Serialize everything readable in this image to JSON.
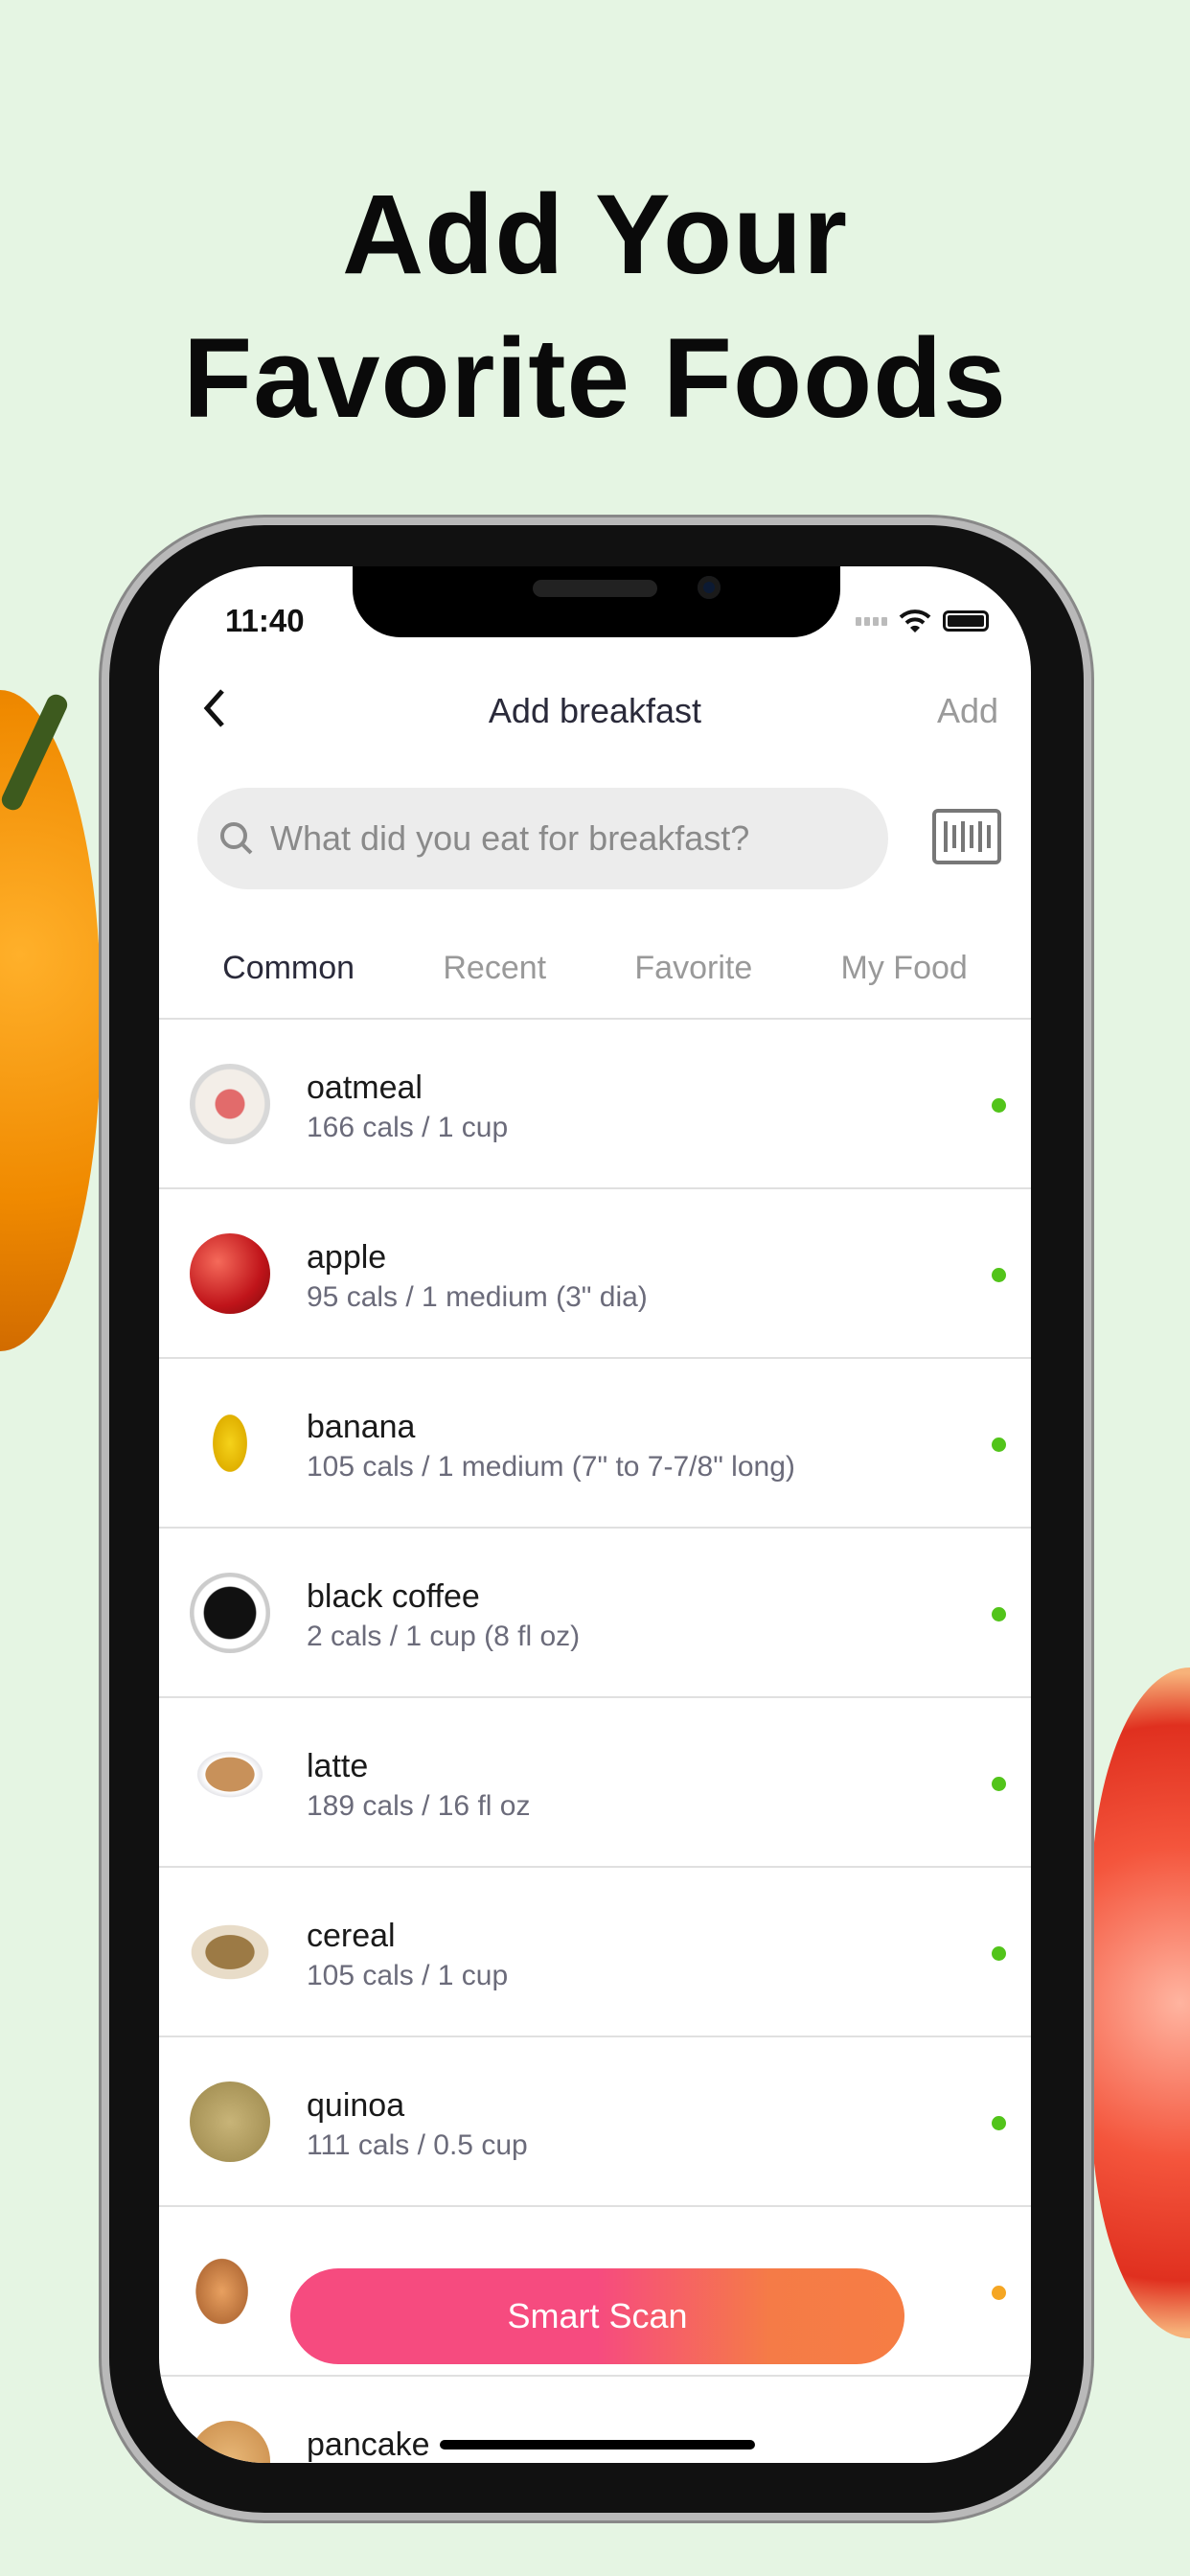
{
  "headline": {
    "line1": "Add Your",
    "line2": "Favorite Foods"
  },
  "status_bar": {
    "time": "11:40"
  },
  "nav": {
    "back_icon": "chevron-left-icon",
    "title": "Add breakfast",
    "add_label": "Add"
  },
  "search": {
    "placeholder": "What did you eat for breakfast?",
    "icon": "search-icon",
    "barcode_icon": "barcode-icon"
  },
  "tabs": [
    {
      "label": "Common",
      "active": true
    },
    {
      "label": "Recent"
    },
    {
      "label": "Favorite"
    },
    {
      "label": "My Food"
    }
  ],
  "foods": [
    {
      "name": "oatmeal",
      "detail": "166 cals / 1 cup",
      "status_color": "#52c41a"
    },
    {
      "name": "apple",
      "detail": "95 cals / 1 medium (3\" dia)",
      "status_color": "#52c41a"
    },
    {
      "name": "banana",
      "detail": "105 cals / 1 medium (7\" to 7-7/8\" long)",
      "status_color": "#52c41a"
    },
    {
      "name": "black coffee",
      "detail": "2 cals / 1 cup (8 fl oz)",
      "status_color": "#52c41a"
    },
    {
      "name": "latte",
      "detail": "189 cals / 16 fl oz",
      "status_color": "#52c41a"
    },
    {
      "name": "cereal",
      "detail": "105 cals / 1 cup",
      "status_color": "#52c41a"
    },
    {
      "name": "quinoa",
      "detail": "111 cals / 0.5 cup",
      "status_color": "#52c41a"
    },
    {
      "name": "",
      "detail": "",
      "status_color": "#f5a623"
    },
    {
      "name": "pancake",
      "detail": ""
    }
  ],
  "smart_scan": {
    "label": "Smart Scan"
  }
}
